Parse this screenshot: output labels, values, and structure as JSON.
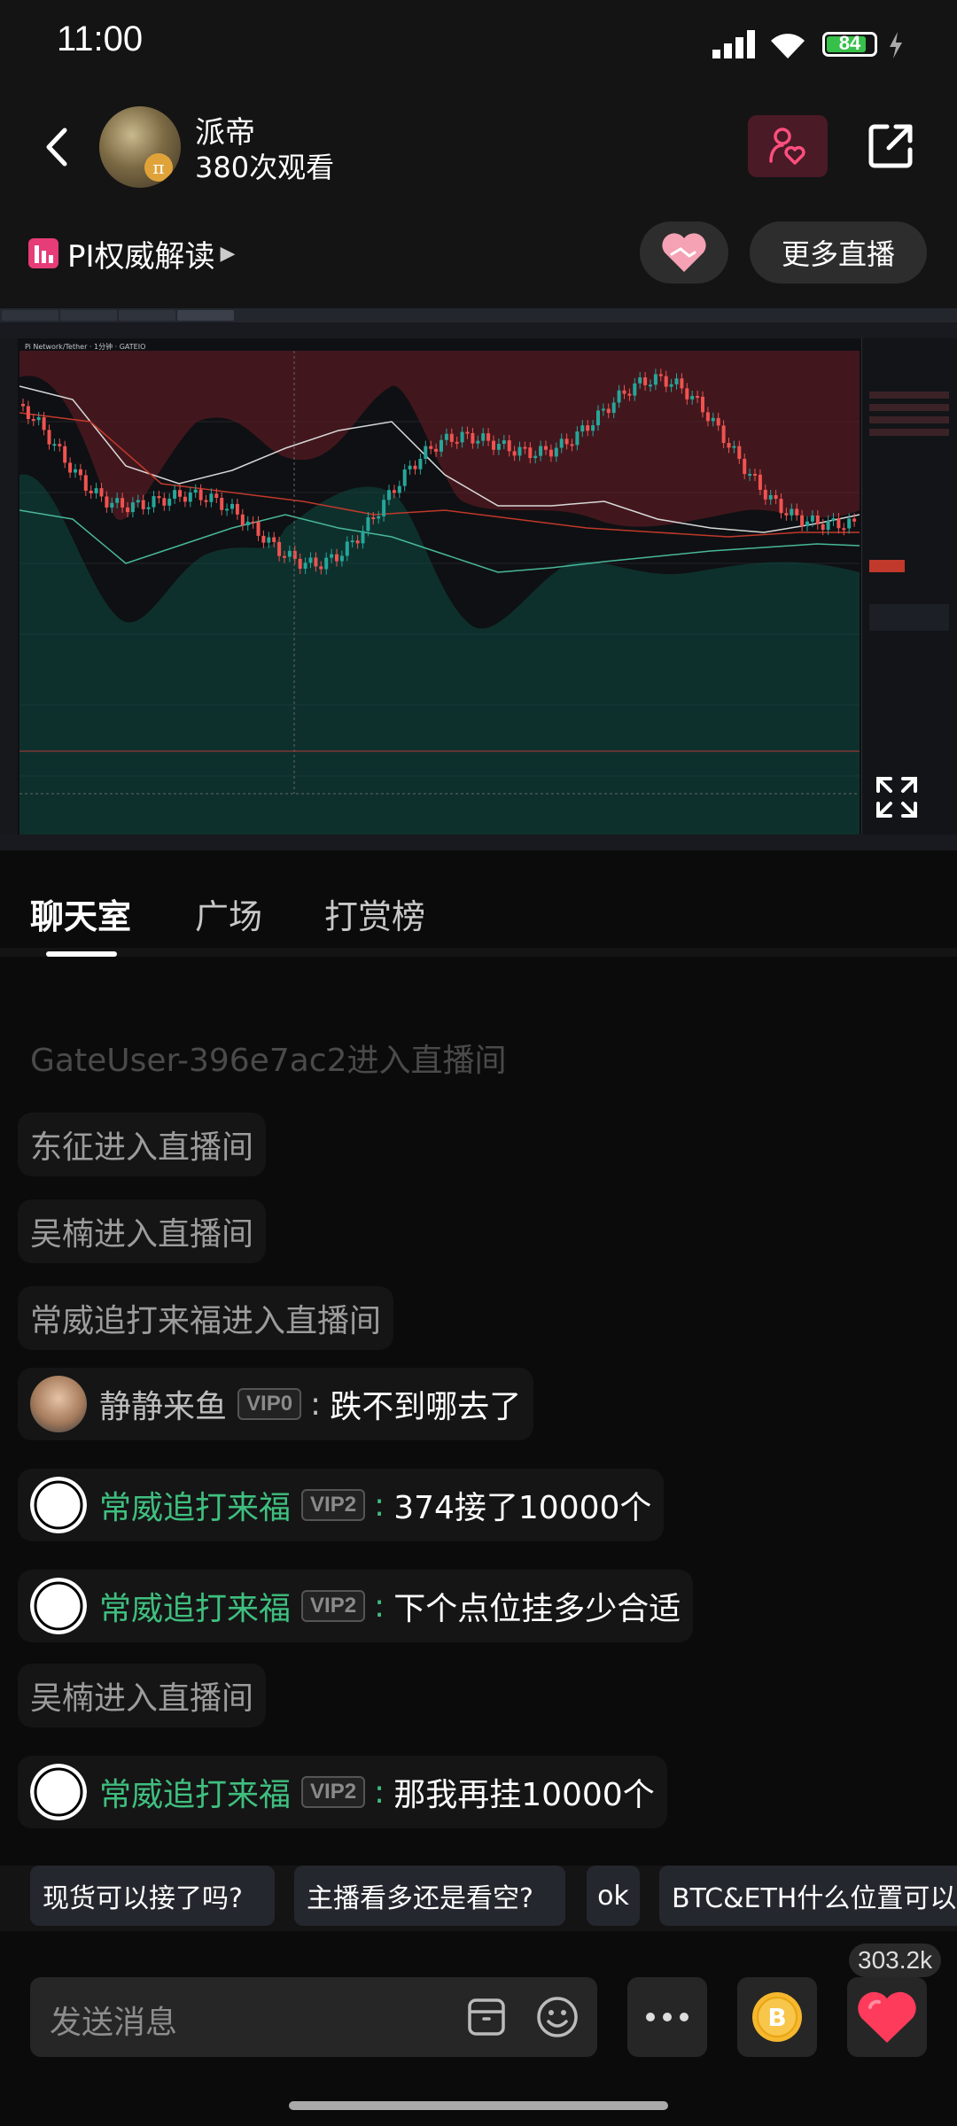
{
  "status": {
    "time": "11:00",
    "battery": "84",
    "battery_level": 0.84
  },
  "header": {
    "host_name": "派帝",
    "views": "380次观看",
    "tag_label": "PI权威解读",
    "more_live": "更多直播"
  },
  "video": {
    "chart_title": "Pi Network/Tether · 1分钟 · GATEIO"
  },
  "tabs": [
    "聊天室",
    "广场",
    "打赏榜"
  ],
  "chat": [
    {
      "type": "enter",
      "text": "GateUser-396e7ac2进入直播间"
    },
    {
      "type": "enter",
      "text": "东征进入直播间"
    },
    {
      "type": "enter",
      "text": "吴楠进入直播间"
    },
    {
      "type": "enter",
      "text": "常威追打来福进入直播间"
    },
    {
      "type": "message",
      "user": "静静来鱼",
      "vip": "VIP0",
      "colon": ":",
      "text": "跌不到哪去了",
      "user_color": "#bdbdbd"
    },
    {
      "type": "message",
      "user": "常威追打来福",
      "vip": "VIP2",
      "colon": ":",
      "text": "374接了10000个",
      "user_color": "#3fbf7f"
    },
    {
      "type": "message",
      "user": "常威追打来福",
      "vip": "VIP2",
      "colon": ":",
      "text": "下个点位挂多少合适",
      "user_color": "#3fbf7f"
    },
    {
      "type": "enter",
      "text": "吴楠进入直播间"
    },
    {
      "type": "message",
      "user": "常威追打来福",
      "vip": "VIP2",
      "colon": ":",
      "text": "那我再挂10000个",
      "user_color": "#3fbf7f"
    }
  ],
  "quick_replies": [
    "现货可以接了吗?",
    "主播看多还是看空?",
    "ok",
    "BTC&ETH什么位置可以"
  ],
  "input": {
    "placeholder": "发送消息",
    "like_count": "303.2k"
  },
  "colors": {
    "accent_green": "#3fbf7f",
    "heart_red": "#ff3b5c",
    "tag_pink": "#e63c78",
    "coin_gold": "#f5b82e"
  }
}
